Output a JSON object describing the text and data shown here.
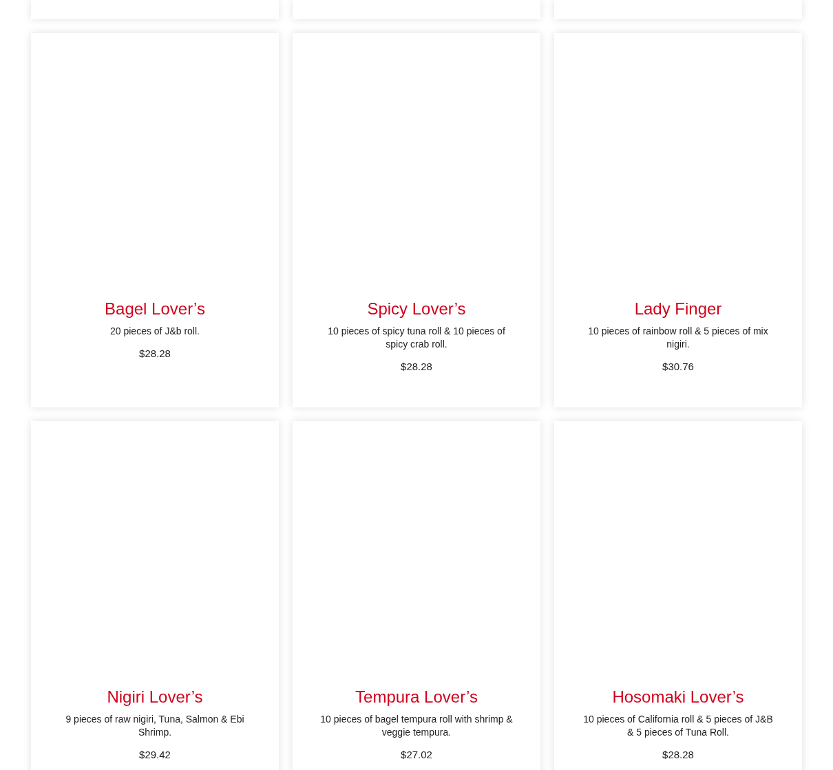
{
  "products": [
    {
      "title": "Bagel Lover’s",
      "description": "20 pieces of J&b roll.",
      "price": "$28.28"
    },
    {
      "title": "Spicy Lover’s",
      "description": "10 pieces of spicy tuna roll & 10 pieces of spicy crab roll.",
      "price": "$28.28"
    },
    {
      "title": "Lady Finger",
      "description": "10 pieces of rainbow roll & 5 pieces of mix nigiri.",
      "price": "$30.76"
    },
    {
      "title": "Nigiri Lover’s",
      "description": "9 pieces of raw nigiri, Tuna, Salmon & Ebi Shrimp.",
      "price": "$29.42"
    },
    {
      "title": "Tempura Lover’s",
      "description": "10 pieces of bagel tempura roll with shrimp & veggie tempura.",
      "price": "$27.02"
    },
    {
      "title": "Hosomaki Lover’s",
      "description": "10 pieces of California roll & 5 pieces of J&B & 5 pieces of Tuna Roll.",
      "price": "$28.28"
    }
  ]
}
